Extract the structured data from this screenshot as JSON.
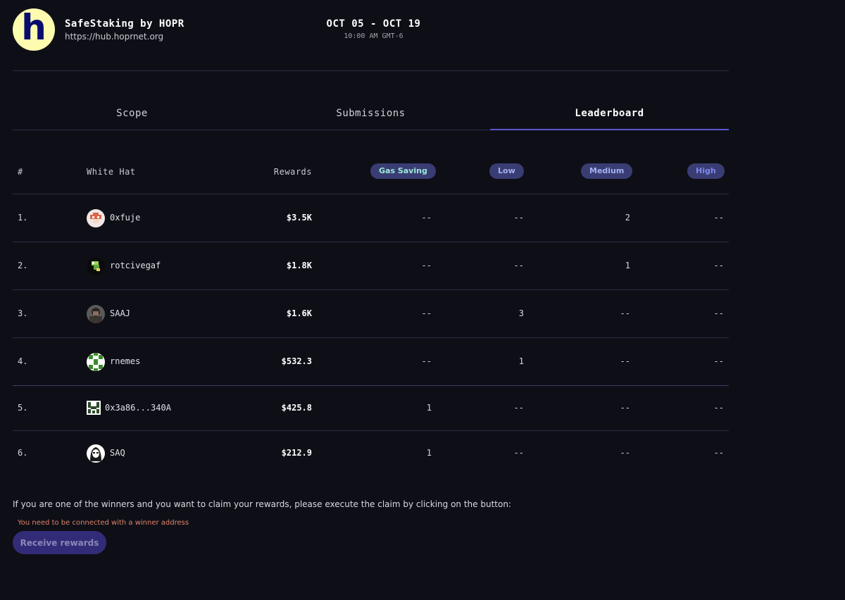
{
  "header": {
    "protocol_name": "SafeStaking by HOPR",
    "protocol_url": "https://hub.hoprnet.org",
    "logo_letter": "h",
    "dates": "OCT 05 - OCT 19",
    "time": "10:00 AM GMT-6"
  },
  "tabs": [
    {
      "label": "Scope",
      "active": false
    },
    {
      "label": "Submissions",
      "active": false
    },
    {
      "label": "Leaderboard",
      "active": true
    }
  ],
  "table": {
    "headers": {
      "rank": "#",
      "white_hat": "White Hat",
      "rewards": "Rewards",
      "gas_saving": "Gas Saving",
      "low": "Low",
      "medium": "Medium",
      "high": "High"
    },
    "rows": [
      {
        "rank": "1.",
        "name": "0xfuje",
        "rewards": "$3.5K",
        "gas": "--",
        "low": "--",
        "medium": "2",
        "high": "--",
        "avatar": "mushroom-avatar"
      },
      {
        "rank": "2.",
        "name": "rotcivegaf",
        "rewards": "$1.8K",
        "gas": "--",
        "low": "--",
        "medium": "1",
        "high": "--",
        "avatar": "frog-avatar"
      },
      {
        "rank": "3.",
        "name": "SAAJ",
        "rewards": "$1.6K",
        "gas": "--",
        "low": "3",
        "medium": "--",
        "high": "--",
        "avatar": "photo-avatar"
      },
      {
        "rank": "4.",
        "name": "rnemes",
        "rewards": "$532.3",
        "gas": "--",
        "low": "1",
        "medium": "--",
        "high": "--",
        "avatar": "green-pattern-avatar"
      },
      {
        "rank": "5.",
        "name": "0x3a86...340A",
        "rewards": "$425.8",
        "gas": "1",
        "low": "--",
        "medium": "--",
        "high": "--",
        "avatar": "identicon-avatar"
      },
      {
        "rank": "6.",
        "name": "SAQ",
        "rewards": "$212.9",
        "gas": "1",
        "low": "--",
        "medium": "--",
        "high": "--",
        "avatar": "hacker-avatar"
      }
    ]
  },
  "footer": {
    "claim_text": "If you are one of the winners and you want to claim your rewards, please execute the claim by clicking on the button:",
    "warning": "You need to be connected with a winner address",
    "button_label": "Receive rewards"
  },
  "colors": {
    "background": "#0e0f16",
    "accent": "#5b57c9",
    "pill": "#3a3d74",
    "warning": "#e0826c",
    "button": "#322c78"
  }
}
